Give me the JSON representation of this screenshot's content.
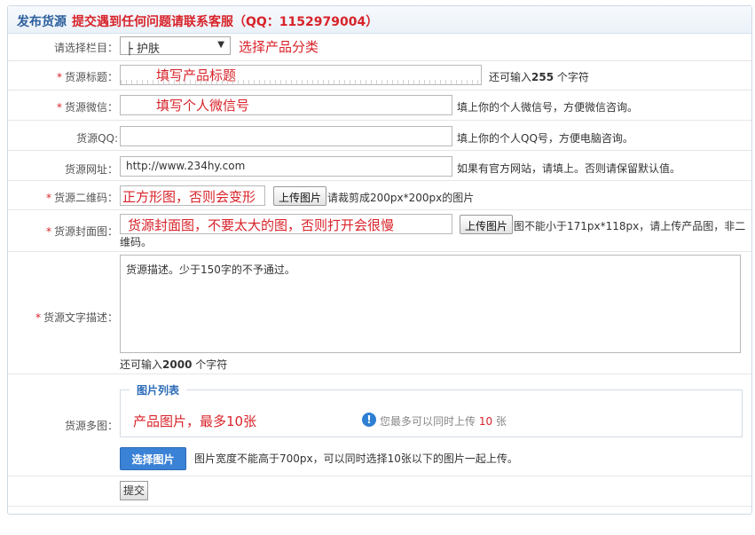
{
  "header": {
    "title": "发布货源",
    "notice": "提交遇到任何问题请联系客服（QQ：1152979004）"
  },
  "category": {
    "label": "请选择栏目：",
    "value": "├ 护肤",
    "hint": "选择产品分类"
  },
  "title_field": {
    "label": "货源标题：",
    "hint": "填写产品标题",
    "note_prefix": "还可输入",
    "count": "255",
    "note_suffix": "个字符"
  },
  "wechat": {
    "label": "货源微信：",
    "hint": "填写个人微信号",
    "note": "填上你的个人微信号，方便微信咨询。"
  },
  "qq": {
    "label": "货源QQ:",
    "note": "填上你的个人QQ号，方便电脑咨询。"
  },
  "website": {
    "label": "货源网址：",
    "value": "http://www.234hy.com",
    "note": "如果有官方网站，请填上。否则请保留默认值。"
  },
  "qrcode": {
    "label": "货源二维码：",
    "hint": "正方形图，否则会变形",
    "button": "上传图片",
    "note": "请裁剪成200px*200px的图片"
  },
  "cover": {
    "label": "货源封面图：",
    "hint": "货源封面图，不要太大的图，否则打开会很慢",
    "button": "上传图片",
    "note_line1": "图不能小于171px*118px，请上传产品图，非二",
    "note_line2": "维码。"
  },
  "description": {
    "label": "货源文字描述：",
    "value": "货源描述。少于150字的不予通过。",
    "note_prefix": "还可输入",
    "count": "2000",
    "note_suffix": "个字符"
  },
  "gallery": {
    "label": "货源多图：",
    "legend": "图片列表",
    "hint": "产品图片，最多10张",
    "info_prefix": "您最多可以同时上传",
    "info_count": "10",
    "info_suffix": "张",
    "select_button": "选择图片",
    "note": "图片宽度不能高于700px，可以同时选择10张以下的图片一起上传。"
  },
  "submit": {
    "label": "提交"
  },
  "colors": {
    "accent": "#3a82d6",
    "required": "#d8232a",
    "title_blue": "#2b5e9c"
  }
}
